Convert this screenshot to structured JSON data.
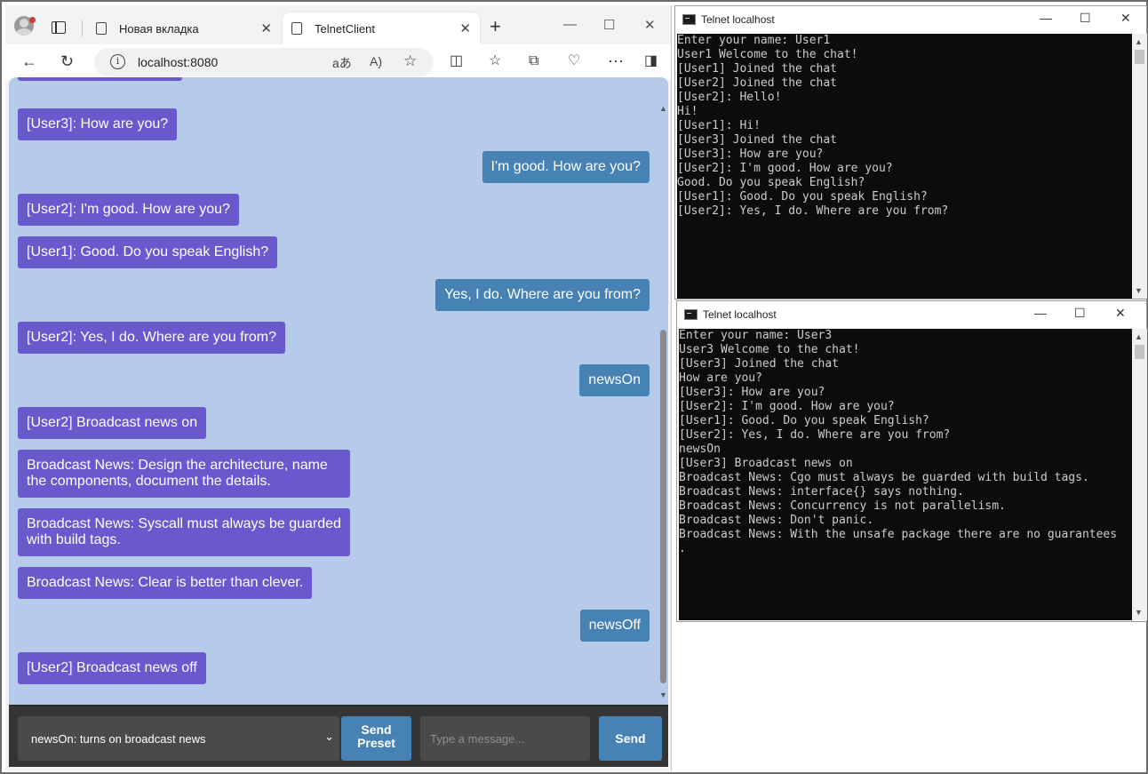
{
  "browser": {
    "inactive_tab_label": "Новая вкладка",
    "active_tab_label": "TelnetClient",
    "new_tab_symbol": "+",
    "url": "localhost:8080",
    "window_controls": {
      "minimize": "—",
      "maximize": "☐",
      "close": "✕"
    }
  },
  "chat": {
    "messages": [
      {
        "text": "[User3]: How are you?",
        "type": "incoming"
      },
      {
        "text": "I'm good. How are you?",
        "type": "outgoing"
      },
      {
        "text": "[User2]: I'm good. How are you?",
        "type": "incoming"
      },
      {
        "text": "[User1]: Good. Do you speak English?",
        "type": "incoming"
      },
      {
        "text": "Yes, I do. Where are you from?",
        "type": "outgoing"
      },
      {
        "text": "[User2]: Yes, I do. Where are you from?",
        "type": "incoming"
      },
      {
        "text": "newsOn",
        "type": "outgoing"
      },
      {
        "text": "[User2] Broadcast news on",
        "type": "incoming"
      },
      {
        "text": "Broadcast News: Design the architecture, name the components, document the details.",
        "type": "incoming"
      },
      {
        "text": "Broadcast News: Syscall must always be guarded with build tags.",
        "type": "incoming"
      },
      {
        "text": "Broadcast News: Clear is better than clever.",
        "type": "incoming"
      },
      {
        "text": "newsOff",
        "type": "outgoing"
      },
      {
        "text": "[User2] Broadcast news off",
        "type": "incoming"
      }
    ],
    "preset_selected": "newsOn: turns on broadcast news",
    "send_preset_label_line1": "Send",
    "send_preset_label_line2": "Preset",
    "message_placeholder": "Type a message...",
    "send_label": "Send",
    "colors": {
      "incoming": "#6a59cd",
      "outgoing": "#4682b4",
      "background": "#b6cbe9",
      "input_bar": "#353535"
    }
  },
  "telnet1": {
    "title": "Telnet localhost",
    "lines": [
      "Enter your name: User1",
      "User1 Welcome to the chat!",
      "[User1] Joined the chat",
      "[User2] Joined the chat",
      "[User2]: Hello!",
      "Hi!",
      "[User1]: Hi!",
      "[User3] Joined the chat",
      "[User3]: How are you?",
      "[User2]: I'm good. How are you?",
      "Good. Do you speak English?",
      "[User1]: Good. Do you speak English?",
      "[User2]: Yes, I do. Where are you from?"
    ]
  },
  "telnet2": {
    "title": "Telnet localhost",
    "lines": [
      "Enter your name: User3",
      "User3 Welcome to the chat!",
      "[User3] Joined the chat",
      "How are you?",
      "[User3]: How are you?",
      "[User2]: I'm good. How are you?",
      "[User1]: Good. Do you speak English?",
      "[User2]: Yes, I do. Where are you from?",
      "newsOn",
      "[User3] Broadcast news on",
      "Broadcast News: Cgo must always be guarded with build tags.",
      "Broadcast News: interface{} says nothing.",
      "Broadcast News: Concurrency is not parallelism.",
      "Broadcast News: Don't panic.",
      "Broadcast News: With the unsafe package there are no guarantees",
      "."
    ]
  }
}
